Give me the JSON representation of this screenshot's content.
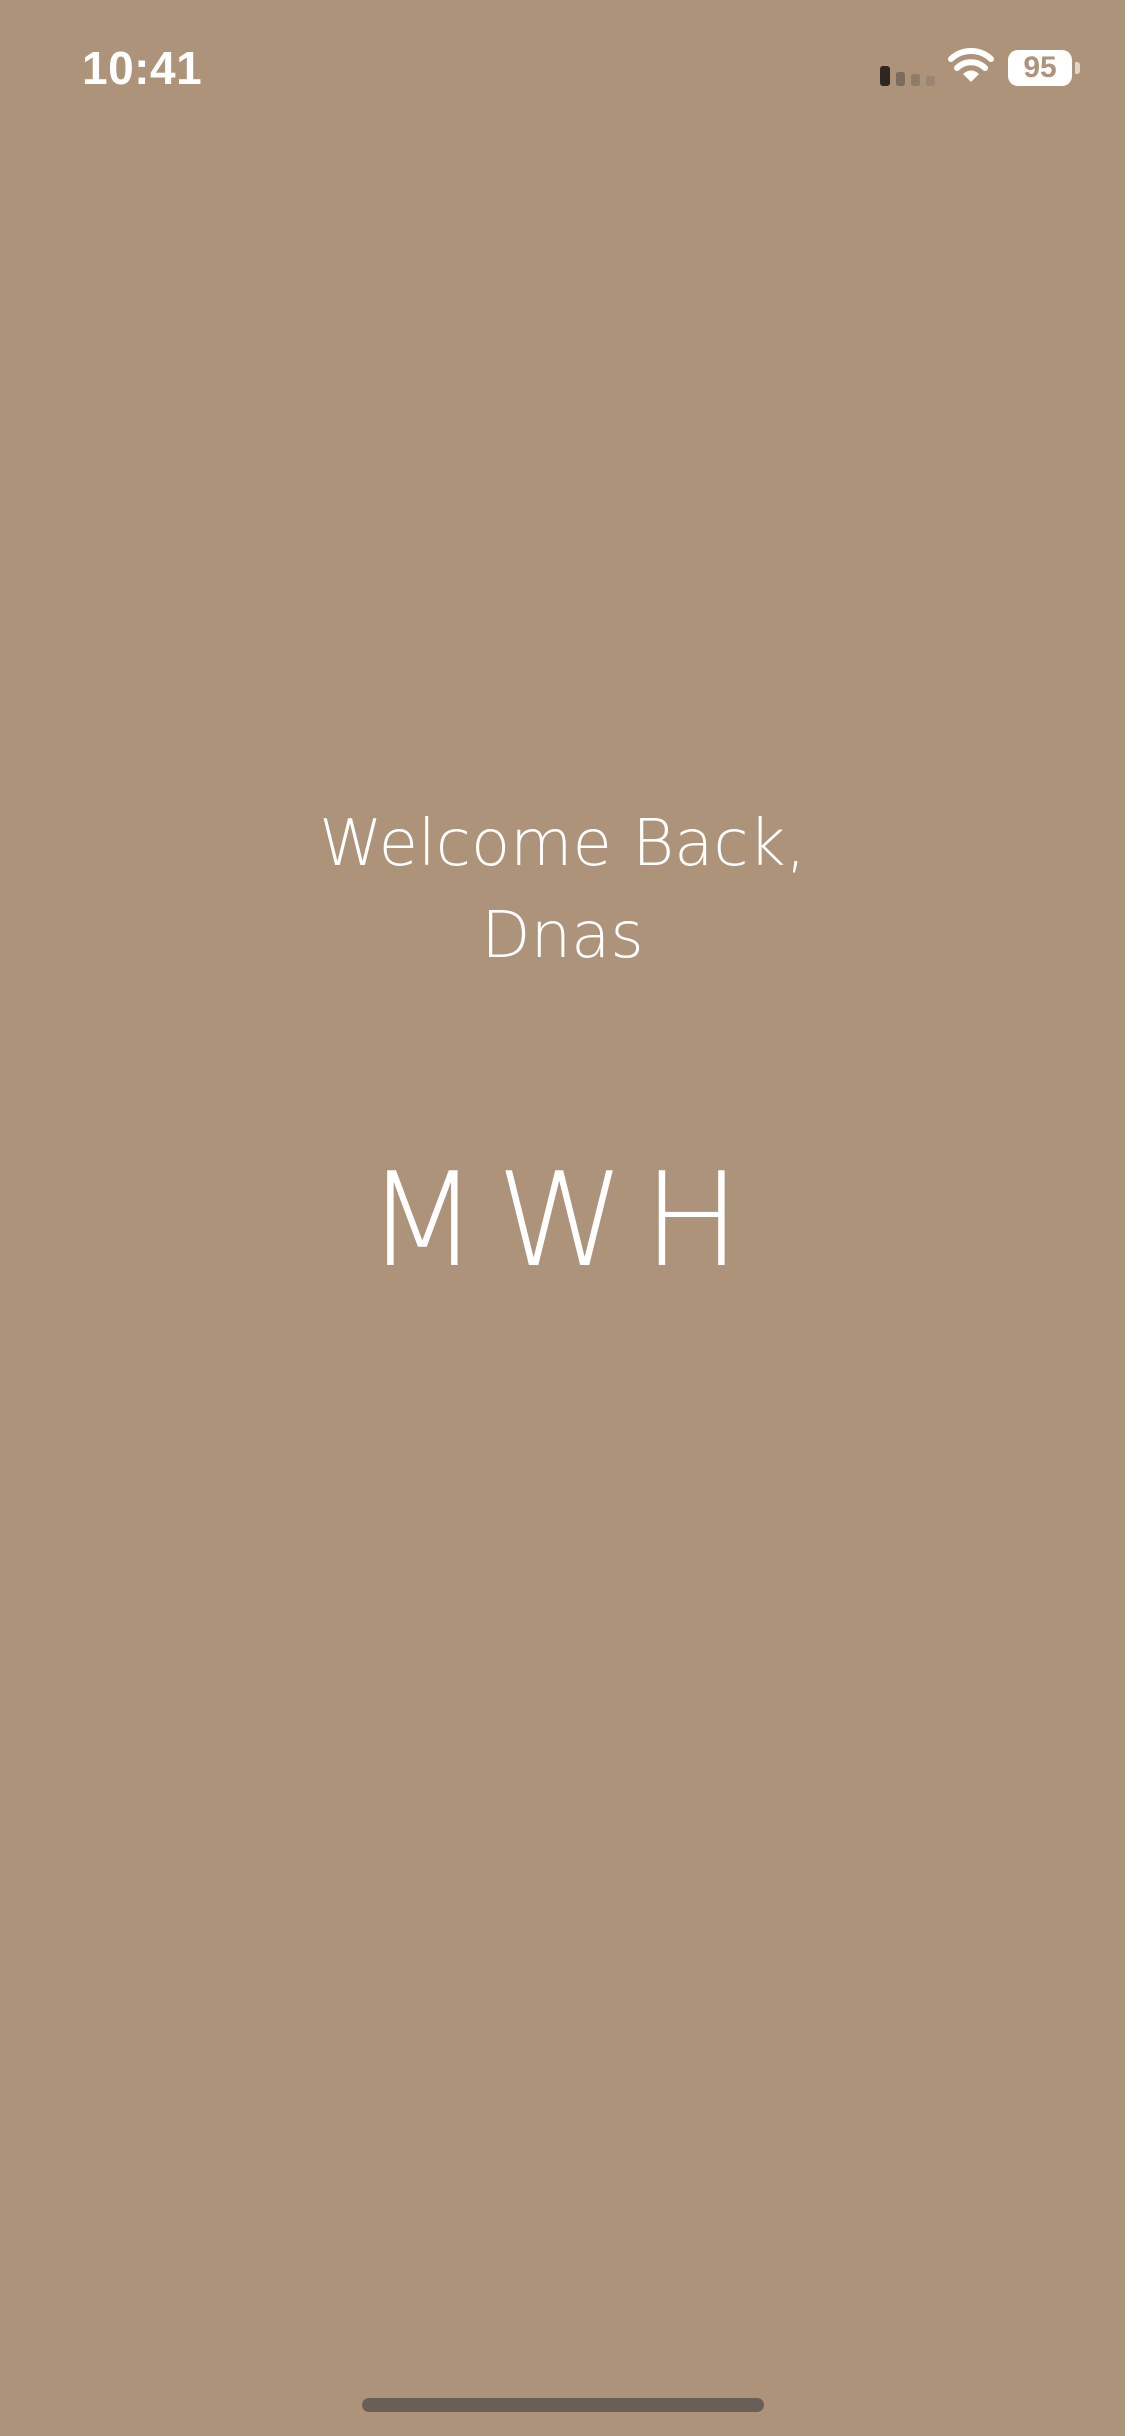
{
  "status_bar": {
    "time": "10:41",
    "battery_level": "95",
    "signal_icon": "cellular-signal-icon",
    "wifi_icon": "wifi-icon",
    "battery_icon": "battery-icon"
  },
  "welcome": {
    "line1": "Welcome Back,",
    "line2": "Dnas"
  },
  "logo": {
    "text": "MWH"
  },
  "colors": {
    "background": "#ad937a",
    "text": "#ffffff",
    "home_indicator": "#6a5f57"
  }
}
